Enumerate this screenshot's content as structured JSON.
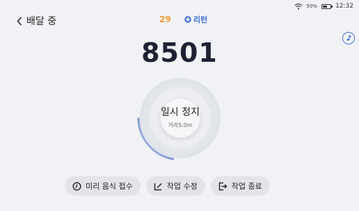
{
  "status_bar": {
    "battery_pct": "50%",
    "time": "12:32",
    "icons": [
      "wifi-icon",
      "battery-icon"
    ]
  },
  "header": {
    "back_label": "배달 중",
    "count": "29",
    "return_label": "리턴",
    "icons": [
      "chevron-left-icon",
      "location-pin-icon"
    ]
  },
  "music_button": {
    "icon": "music-note-icon"
  },
  "order_code": "8501",
  "pause_control": {
    "label": "일시 정지",
    "distance": "거리5.0m",
    "progress_fraction": 0.22
  },
  "actions": [
    {
      "label": "미리 음식 접수",
      "icon": "clock-icon"
    },
    {
      "label": "작업 수정",
      "icon": "edit-icon"
    },
    {
      "label": "작업 종료",
      "icon": "exit-icon"
    }
  ],
  "colors": {
    "background": "#f1f2f5",
    "accent_blue": "#3d6fd6",
    "count_orange": "#f39b2f",
    "code_text": "#1f2133"
  }
}
